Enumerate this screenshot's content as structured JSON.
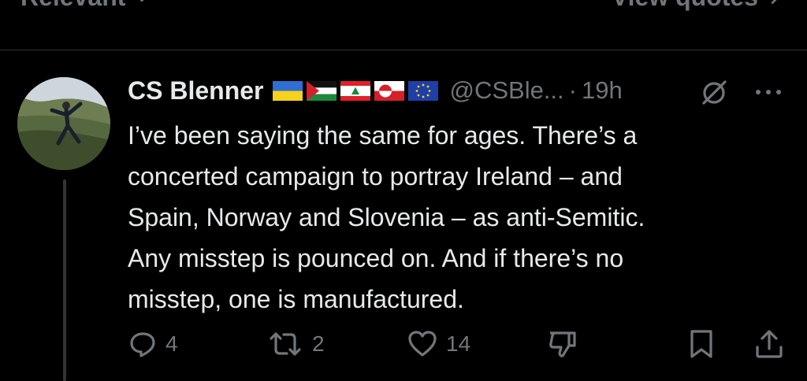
{
  "topbar": {
    "sort_label": "Relevant",
    "view_quotes_label": "View quotes"
  },
  "tweet": {
    "display_name": "CS Blenner",
    "flags": [
      "ukraine-flag",
      "palestine-flag",
      "lebanon-flag",
      "greenland-flag",
      "eu-flag"
    ],
    "handle": "@CSBle...",
    "separator": "·",
    "time": "19h",
    "body_lines": [
      "I’ve been saying the same for ages. There’s a",
      "concerted campaign to portray Ireland – and",
      "Spain, Norway and Slovenia – as anti-Semitic.",
      "Any misstep is pounced on. And if there’s no",
      "misstep, one is manufactured."
    ],
    "reply_count": "4",
    "repost_count": "2",
    "like_count": "14"
  },
  "colors": {
    "background": "#000000",
    "text": "#e7e9ea",
    "muted": "#71767b",
    "divider": "#2f3336"
  }
}
